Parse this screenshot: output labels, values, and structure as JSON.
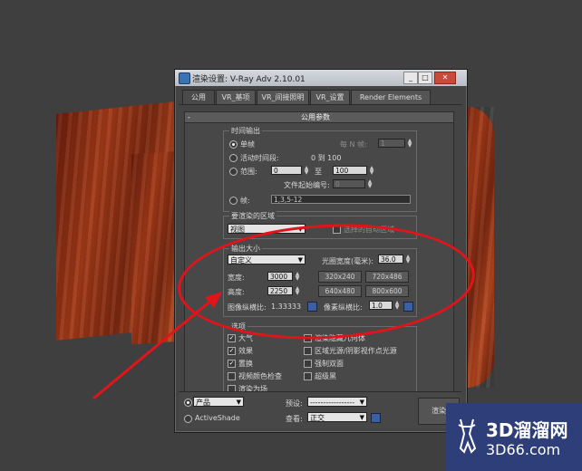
{
  "window": {
    "title": "渲染设置: V-Ray Adv 2.10.01",
    "min": "_",
    "max": "□",
    "close": "✕"
  },
  "tabs": [
    "公用",
    "VR_基项",
    "VR_间接照明",
    "VR_设置",
    "Render Elements"
  ],
  "rollout": {
    "toggle": "-",
    "title": "公用参数"
  },
  "time_output": {
    "title": "时间输出",
    "single": "单帧",
    "every_n": "每 N 帧:",
    "every_n_value": "1",
    "active_segment": "活动时间段:",
    "active_range": "0 到 100",
    "range": "范围:",
    "range_from": "0",
    "range_to_label": "至",
    "range_to": "100",
    "file_number": "文件起始编号:",
    "file_number_value": "0",
    "frames": "帧:",
    "frames_value": "1,3,5-12"
  },
  "render_area": {
    "title": "要渲染的区域",
    "mode": "视图",
    "auto_region": "选择的自动区域"
  },
  "output_size": {
    "title": "输出大小",
    "preset": "自定义",
    "aperture_label": "光圈宽度(毫米):",
    "aperture_value": "36.0",
    "width_label": "宽度:",
    "width_value": "3000",
    "height_label": "高度:",
    "height_value": "2250",
    "presets": [
      "320x240",
      "720x486",
      "640x480",
      "800x600"
    ],
    "image_aspect_label": "图像纵横比:",
    "image_aspect_value": "1.33333",
    "pixel_aspect_label": "像素纵横比:",
    "pixel_aspect_value": "1.0"
  },
  "options": {
    "title": "选项",
    "items_left": [
      {
        "label": "大气",
        "checked": true
      },
      {
        "label": "效果",
        "checked": true
      },
      {
        "label": "置换",
        "checked": true
      },
      {
        "label": "视频颜色检查",
        "checked": false
      },
      {
        "label": "渲染为场",
        "checked": false
      }
    ],
    "items_right": [
      {
        "label": "渲染隐藏几何体",
        "checked": false
      },
      {
        "label": "区域光源/阴影视作点光源",
        "checked": false
      },
      {
        "label": "强制双面",
        "checked": false
      },
      {
        "label": "超级黑",
        "checked": false
      }
    ]
  },
  "bottom": {
    "product": "产品",
    "activeshade": "ActiveShade",
    "preset_label": "预设:",
    "preset_value": "-----------------",
    "view_label": "查看:",
    "view_value": "正交",
    "render": "渲染"
  },
  "watermark": {
    "line1": "3D溜溜网",
    "line2": "3D66.com"
  },
  "colors": {
    "annotation_red": "#e1141a",
    "logo_blue": "#2e3e78"
  }
}
